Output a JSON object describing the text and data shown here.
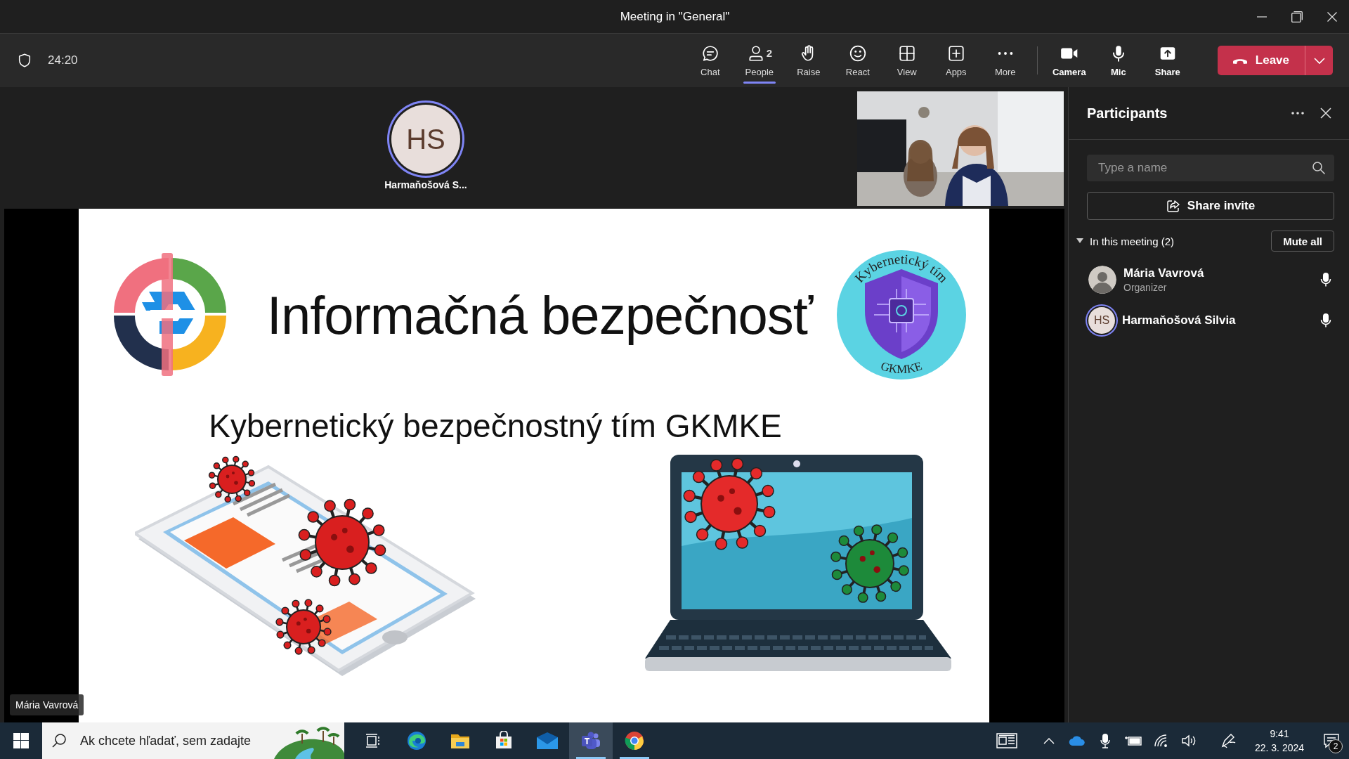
{
  "window": {
    "title": "Meeting in \"General\""
  },
  "toolbar": {
    "timer": "24:20",
    "actions": [
      {
        "kind": "chat",
        "label": "Chat",
        "selected": false
      },
      {
        "kind": "people",
        "label": "People",
        "count": "2",
        "selected": true
      },
      {
        "kind": "raise",
        "label": "Raise",
        "selected": false
      },
      {
        "kind": "react",
        "label": "React",
        "selected": false
      },
      {
        "kind": "view",
        "label": "View",
        "selected": false
      },
      {
        "kind": "apps",
        "label": "Apps",
        "selected": false
      },
      {
        "kind": "more",
        "label": "More",
        "selected": false
      }
    ],
    "devices": [
      {
        "kind": "camera",
        "label": "Camera"
      },
      {
        "kind": "mic",
        "label": "Mic"
      },
      {
        "kind": "share",
        "label": "Share"
      }
    ],
    "leave": "Leave"
  },
  "stage": {
    "spotlight": {
      "initials": "HS",
      "name": "Harmaňošová S..."
    },
    "slide": {
      "title": "Informačná bezpečnosť",
      "subtitle": "Kybernetický bezpečnostný tím GKMKE",
      "emblem_top": "Kybernetický tím",
      "emblem_bottom": "GKMKE"
    },
    "presenter": "Mária Vavrová"
  },
  "panel": {
    "title": "Participants",
    "search": {
      "placeholder": "Type a name"
    },
    "share_invite": "Share invite",
    "section": {
      "label": "In this meeting (2)",
      "expanded": true
    },
    "mute_all": "Mute all",
    "participants": [
      {
        "name": "Mária Vavrová",
        "role": "Organizer"
      },
      {
        "kind": "initials",
        "initials": "HS",
        "name": "Harmaňošová Silvia"
      }
    ]
  },
  "taskbar": {
    "search": {
      "placeholder": "Ak chcete hľadať, sem zadajte"
    },
    "apps": [
      {
        "kind": "taskview",
        "selected": false,
        "running": false
      },
      {
        "kind": "edge",
        "selected": false,
        "running": false
      },
      {
        "kind": "explorer",
        "selected": false,
        "running": false
      },
      {
        "kind": "store",
        "selected": false,
        "running": false
      },
      {
        "kind": "mail",
        "selected": false,
        "running": false
      },
      {
        "kind": "teams",
        "selected": true,
        "running": true
      },
      {
        "kind": "chrome",
        "selected": false,
        "running": true
      }
    ],
    "time": "9:41",
    "date": "22. 3. 2024",
    "notifications": "2"
  }
}
